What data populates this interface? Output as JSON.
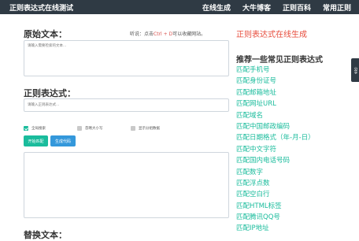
{
  "navbar": {
    "brand": "正则表达式在线测试",
    "links": [
      "在线生成",
      "大牛博客",
      "正则百科",
      "常用正则"
    ]
  },
  "main": {
    "source_label": "原始文本：",
    "tip_prefix": "听说：点击",
    "tip_key": "Ctrl + D",
    "tip_suffix": "可以收藏网站。",
    "source_placeholder": "请输入需要检索的文本...",
    "regex_label": "正则表达式：",
    "regex_placeholder": "请输入正则表达式...",
    "options": [
      {
        "label": "全局搜索",
        "checked": true
      },
      {
        "label": "忽略大小写",
        "checked": false
      },
      {
        "label": "显示分组数据",
        "checked": false
      }
    ],
    "match_button": "开始匹配",
    "generate_button": "生成代码",
    "replace_label": "替换文本："
  },
  "sidebar": {
    "title": "正则表达式在线生成",
    "heading": "推荐一些常见正则表达式",
    "items": [
      "匹配手机号",
      "匹配身份证号",
      "匹配邮箱地址",
      "匹配网址URL",
      "匹配域名",
      "匹配中国邮政编码",
      "匹配日期格式（年-月-日）",
      "匹配中文字符",
      "匹配国内电话号码",
      "匹配数字",
      "匹配浮点数",
      "匹配空白行",
      "匹配HTML标签",
      "匹配腾讯QQ号",
      "匹配IP地址"
    ]
  },
  "share": {
    "label": "分享"
  },
  "colors": {
    "navbar": "#2f3a44",
    "accent_green": "#1abc9c",
    "accent_blue": "#3498db",
    "accent_red": "#e74c3c"
  }
}
